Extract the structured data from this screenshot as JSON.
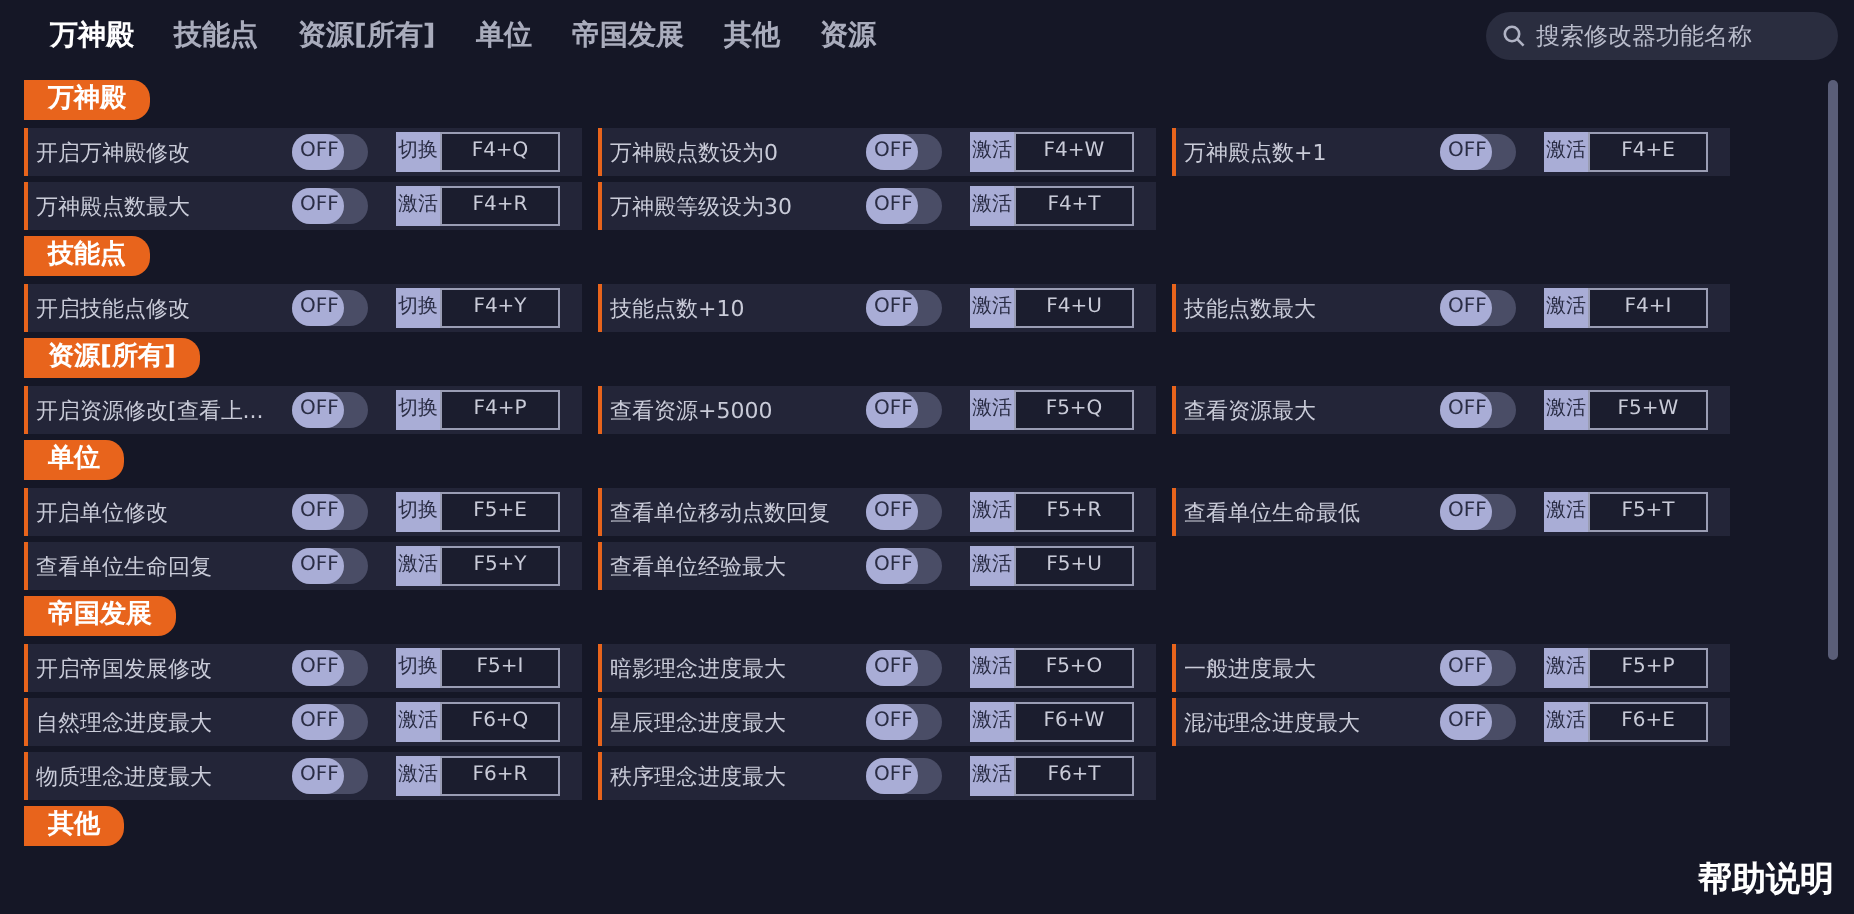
{
  "tabs": [
    {
      "label": "万神殿",
      "selected": true
    },
    {
      "label": "技能点",
      "selected": false
    },
    {
      "label": "资源[所有]",
      "selected": false
    },
    {
      "label": "单位",
      "selected": false
    },
    {
      "label": "帝国发展",
      "selected": false
    },
    {
      "label": "其他",
      "selected": false
    },
    {
      "label": "资源",
      "selected": false
    }
  ],
  "search": {
    "placeholder": "搜索修改器功能名称"
  },
  "sections": [
    {
      "title": "万神殿",
      "items": [
        {
          "label": "开启万神殿修改",
          "toggle": "OFF",
          "on": false,
          "action": "切换",
          "hotkey": "F4+Q"
        },
        {
          "label": "万神殿点数设为0",
          "toggle": "OFF",
          "on": false,
          "action": "激活",
          "hotkey": "F4+W"
        },
        {
          "label": "万神殿点数+1",
          "toggle": "OFF",
          "on": false,
          "action": "激活",
          "hotkey": "F4+E"
        },
        {
          "label": "万神殿点数最大",
          "toggle": "OFF",
          "on": false,
          "action": "激活",
          "hotkey": "F4+R"
        },
        {
          "label": "万神殿等级设为30",
          "toggle": "OFF",
          "on": false,
          "action": "激活",
          "hotkey": "F4+T"
        }
      ]
    },
    {
      "title": "技能点",
      "items": [
        {
          "label": "开启技能点修改",
          "toggle": "OFF",
          "on": false,
          "action": "切换",
          "hotkey": "F4+Y"
        },
        {
          "label": "技能点数+10",
          "toggle": "OFF",
          "on": false,
          "action": "激活",
          "hotkey": "F4+U"
        },
        {
          "label": "技能点数最大",
          "toggle": "OFF",
          "on": false,
          "action": "激活",
          "hotkey": "F4+I"
        }
      ]
    },
    {
      "title": "资源[所有]",
      "items": [
        {
          "label": "开启资源修改[查看上...",
          "toggle": "OFF",
          "on": false,
          "action": "切换",
          "hotkey": "F4+P"
        },
        {
          "label": "查看资源+5000",
          "toggle": "OFF",
          "on": false,
          "action": "激活",
          "hotkey": "F5+Q"
        },
        {
          "label": "查看资源最大",
          "toggle": "OFF",
          "on": false,
          "action": "激活",
          "hotkey": "F5+W"
        }
      ]
    },
    {
      "title": "单位",
      "items": [
        {
          "label": "开启单位修改",
          "toggle": "OFF",
          "on": false,
          "action": "切换",
          "hotkey": "F5+E"
        },
        {
          "label": "查看单位移动点数回复",
          "toggle": "OFF",
          "on": false,
          "action": "激活",
          "hotkey": "F5+R"
        },
        {
          "label": "查看单位生命最低",
          "toggle": "OFF",
          "on": false,
          "action": "激活",
          "hotkey": "F5+T"
        },
        {
          "label": "查看单位生命回复",
          "toggle": "OFF",
          "on": false,
          "action": "激活",
          "hotkey": "F5+Y"
        },
        {
          "label": "查看单位经验最大",
          "toggle": "OFF",
          "on": false,
          "action": "激活",
          "hotkey": "F5+U"
        }
      ]
    },
    {
      "title": "帝国发展",
      "items": [
        {
          "label": "开启帝国发展修改",
          "toggle": "OFF",
          "on": false,
          "action": "切换",
          "hotkey": "F5+I"
        },
        {
          "label": "暗影理念进度最大",
          "toggle": "OFF",
          "on": false,
          "action": "激活",
          "hotkey": "F5+O"
        },
        {
          "label": "一般进度最大",
          "toggle": "OFF",
          "on": false,
          "action": "激活",
          "hotkey": "F5+P"
        },
        {
          "label": "自然理念进度最大",
          "toggle": "OFF",
          "on": false,
          "action": "激活",
          "hotkey": "F6+Q"
        },
        {
          "label": "星辰理念进度最大",
          "toggle": "OFF",
          "on": false,
          "action": "激活",
          "hotkey": "F6+W"
        },
        {
          "label": "混沌理念进度最大",
          "toggle": "OFF",
          "on": false,
          "action": "激活",
          "hotkey": "F6+E"
        },
        {
          "label": "物质理念进度最大",
          "toggle": "OFF",
          "on": false,
          "action": "激活",
          "hotkey": "F6+R"
        },
        {
          "label": "秩序理念进度最大",
          "toggle": "OFF",
          "on": false,
          "action": "激活",
          "hotkey": "F6+T"
        }
      ]
    },
    {
      "title": "其他"
    }
  ],
  "help_link": "帮助说明"
}
